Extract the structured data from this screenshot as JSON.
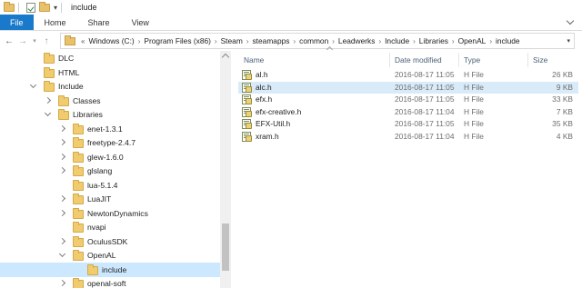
{
  "window": {
    "title": "include"
  },
  "ribbon": {
    "tabs": [
      "File",
      "Home",
      "Share",
      "View"
    ]
  },
  "address": {
    "overflow": "«",
    "crumbs": [
      "Windows (C:)",
      "Program Files (x86)",
      "Steam",
      "steamapps",
      "common",
      "Leadwerks",
      "Include",
      "Libraries",
      "OpenAL",
      "include"
    ]
  },
  "tree": [
    {
      "label": "DLC",
      "level": 2,
      "arrow": "none",
      "selected": false
    },
    {
      "label": "HTML",
      "level": 2,
      "arrow": "none",
      "selected": false
    },
    {
      "label": "Include",
      "level": 2,
      "arrow": "open",
      "selected": false
    },
    {
      "label": "Classes",
      "level": 3,
      "arrow": "closed",
      "selected": false
    },
    {
      "label": "Libraries",
      "level": 3,
      "arrow": "open",
      "selected": false
    },
    {
      "label": "enet-1.3.1",
      "level": 4,
      "arrow": "closed",
      "selected": false
    },
    {
      "label": "freetype-2.4.7",
      "level": 4,
      "arrow": "closed",
      "selected": false
    },
    {
      "label": "glew-1.6.0",
      "level": 4,
      "arrow": "closed",
      "selected": false
    },
    {
      "label": "glslang",
      "level": 4,
      "arrow": "closed",
      "selected": false
    },
    {
      "label": "lua-5.1.4",
      "level": 4,
      "arrow": "none",
      "selected": false
    },
    {
      "label": "LuaJIT",
      "level": 4,
      "arrow": "closed",
      "selected": false
    },
    {
      "label": "NewtonDynamics",
      "level": 4,
      "arrow": "closed",
      "selected": false
    },
    {
      "label": "nvapi",
      "level": 4,
      "arrow": "none",
      "selected": false
    },
    {
      "label": "OculusSDK",
      "level": 4,
      "arrow": "closed",
      "selected": false
    },
    {
      "label": "OpenAL",
      "level": 4,
      "arrow": "open",
      "selected": false
    },
    {
      "label": "include",
      "level": 5,
      "arrow": "none",
      "selected": true
    },
    {
      "label": "openal-soft",
      "level": 4,
      "arrow": "closed",
      "selected": false
    }
  ],
  "columns": {
    "name": "Name",
    "date": "Date modified",
    "type": "Type",
    "size": "Size"
  },
  "files": [
    {
      "name": "al.h",
      "date": "2016-08-17 11:05",
      "type": "H File",
      "size": "26 KB",
      "selected": false
    },
    {
      "name": "alc.h",
      "date": "2016-08-17 11:05",
      "type": "H File",
      "size": "9 KB",
      "selected": true
    },
    {
      "name": "efx.h",
      "date": "2016-08-17 11:05",
      "type": "H File",
      "size": "33 KB",
      "selected": false
    },
    {
      "name": "efx-creative.h",
      "date": "2016-08-17 11:04",
      "type": "H File",
      "size": "7 KB",
      "selected": false
    },
    {
      "name": "EFX-Util.h",
      "date": "2016-08-17 11:05",
      "type": "H File",
      "size": "35 KB",
      "selected": false
    },
    {
      "name": "xram.h",
      "date": "2016-08-17 11:04",
      "type": "H File",
      "size": "4 KB",
      "selected": false
    }
  ]
}
